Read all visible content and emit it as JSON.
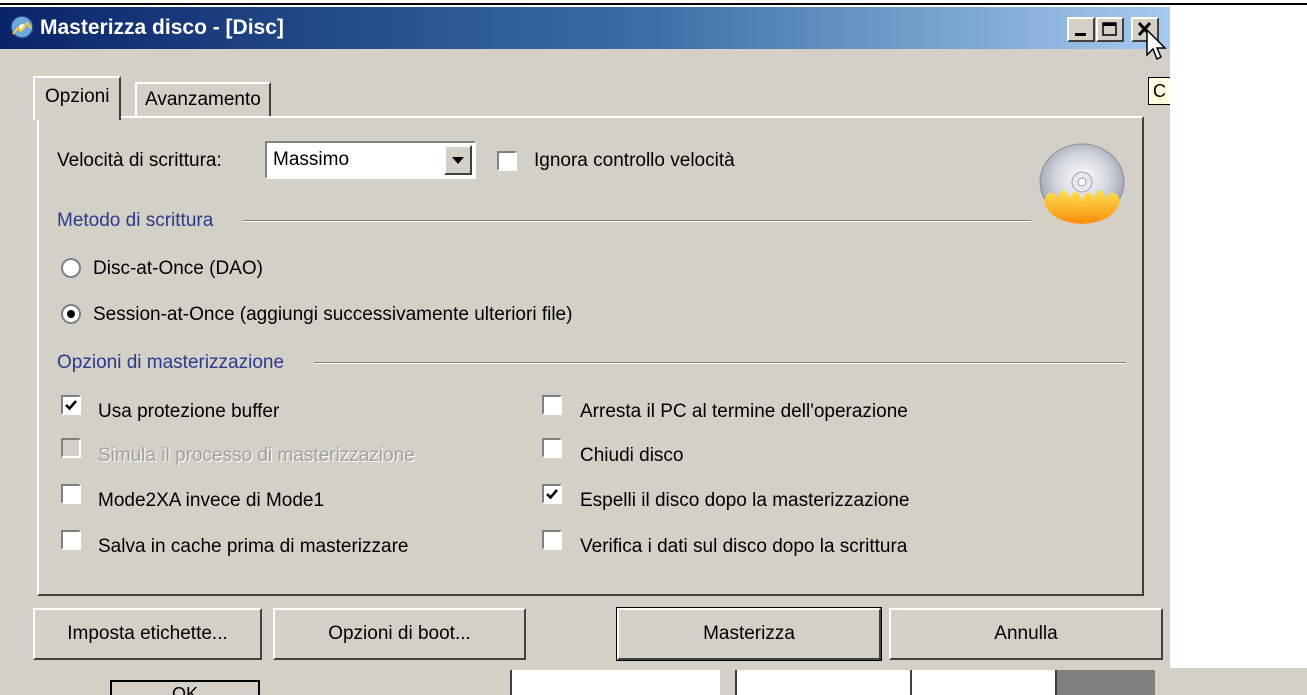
{
  "window": {
    "title": "Masterizza disco - [Disc]",
    "tooltip_fragment": "C"
  },
  "tabs": [
    {
      "label": "Opzioni",
      "active": true
    },
    {
      "label": "Avanzamento",
      "active": false
    }
  ],
  "speed": {
    "label": "Velocità di scrittura:",
    "value": "Massimo",
    "ignore_check_label": "Ignora controllo velocità",
    "ignore_checked": false
  },
  "write_method": {
    "group_label": "Metodo di scrittura",
    "options": [
      {
        "label": "Disc-at-Once (DAO)",
        "selected": false
      },
      {
        "label": "Session-at-Once (aggiungi successivamente ulteriori file)",
        "selected": true
      }
    ]
  },
  "burn_options": {
    "group_label": "Opzioni di masterizzazione",
    "left": [
      {
        "label": "Usa protezione buffer",
        "checked": true,
        "enabled": true
      },
      {
        "label": "Simula il processo di masterizzazione",
        "checked": false,
        "enabled": false
      },
      {
        "label": "Mode2XA invece di Mode1",
        "checked": false,
        "enabled": true
      },
      {
        "label": "Salva in cache prima di masterizzare",
        "checked": false,
        "enabled": true
      }
    ],
    "right": [
      {
        "label": "Arresta il PC al termine dell'operazione",
        "checked": false,
        "enabled": true
      },
      {
        "label": "Chiudi disco",
        "checked": false,
        "enabled": true
      },
      {
        "label": "Espelli il disco dopo la masterizzazione",
        "checked": true,
        "enabled": true
      },
      {
        "label": "Verifica i dati sul disco dopo la scrittura",
        "checked": false,
        "enabled": true
      }
    ]
  },
  "buttons": {
    "labels": "Imposta etichette...",
    "boot": "Opzioni di boot...",
    "burn": "Masterizza",
    "cancel": "Annulla"
  },
  "background": {
    "ok_label": "OK"
  },
  "icons": {
    "app": "disc-burn-app-icon",
    "disc": "burning-disc-icon",
    "minimize": "minimize-icon",
    "maximize": "maximize-icon",
    "close": "close-icon",
    "dropdown": "chevron-down-icon",
    "cursor": "mouse-pointer-icon"
  },
  "colors": {
    "title_gradient_start": "#0a246a",
    "title_gradient_end": "#a6caf0",
    "face": "#d4d0c8",
    "group_label": "#2a3a8c"
  }
}
